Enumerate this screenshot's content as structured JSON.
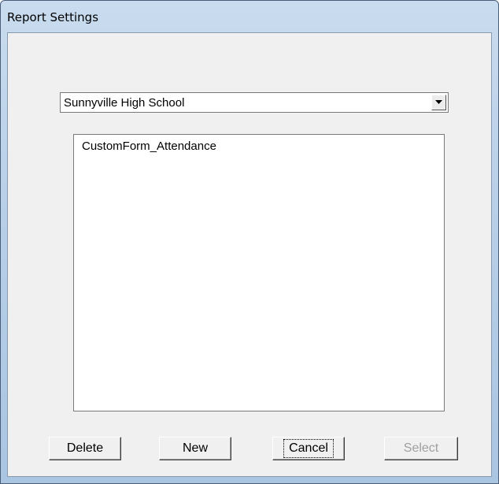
{
  "window": {
    "title": "Report Settings"
  },
  "school_combo": {
    "selected": "Sunnyville High School",
    "arrow_icon": "chevron-down-icon"
  },
  "forms_list": {
    "items": [
      "CustomForm_Attendance"
    ]
  },
  "buttons": {
    "delete": "Delete",
    "new": "New",
    "cancel": "Cancel",
    "select": "Select"
  },
  "colors": {
    "frame": "#b9d0e8",
    "client_bg": "#f0f0f0",
    "disabled_text": "#a0a0a0"
  }
}
